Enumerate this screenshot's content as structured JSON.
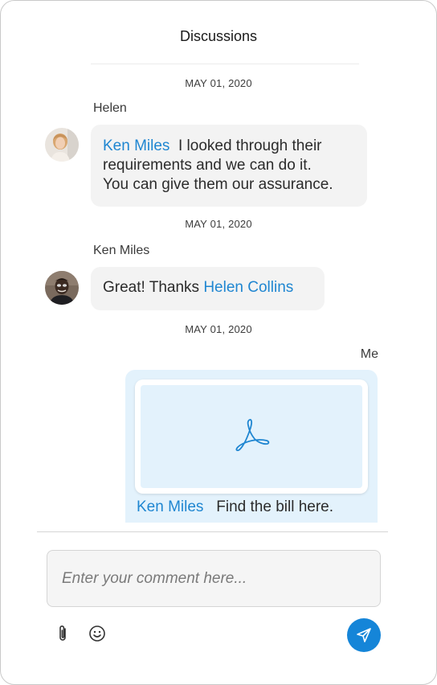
{
  "header": {
    "title": "Discussions"
  },
  "messages": [
    {
      "date": "MAY 01, 2020",
      "sender": "Helen",
      "mention": "Ken Miles",
      "text_line1": "I looked through their",
      "text_line2": "requirements and we can do it.",
      "text_line3": "You can give them our assurance."
    },
    {
      "date": "MAY 01, 2020",
      "sender": "Ken Miles",
      "text": "Great! Thanks ",
      "mention": "Helen Collins"
    },
    {
      "date": "MAY 01, 2020",
      "sender": "Me",
      "mention": "Ken Miles",
      "text": "Find the bill here.",
      "attachment_icon": "pdf-icon"
    }
  ],
  "composer": {
    "placeholder": "Enter your comment here...",
    "attach_icon": "paperclip-icon",
    "emoji_icon": "smiley-icon",
    "send_icon": "send-icon"
  },
  "colors": {
    "accent": "#1585d8",
    "mention": "#1f86d1",
    "bubble_other": "#f3f3f3",
    "bubble_mine": "#e3f2fc"
  }
}
